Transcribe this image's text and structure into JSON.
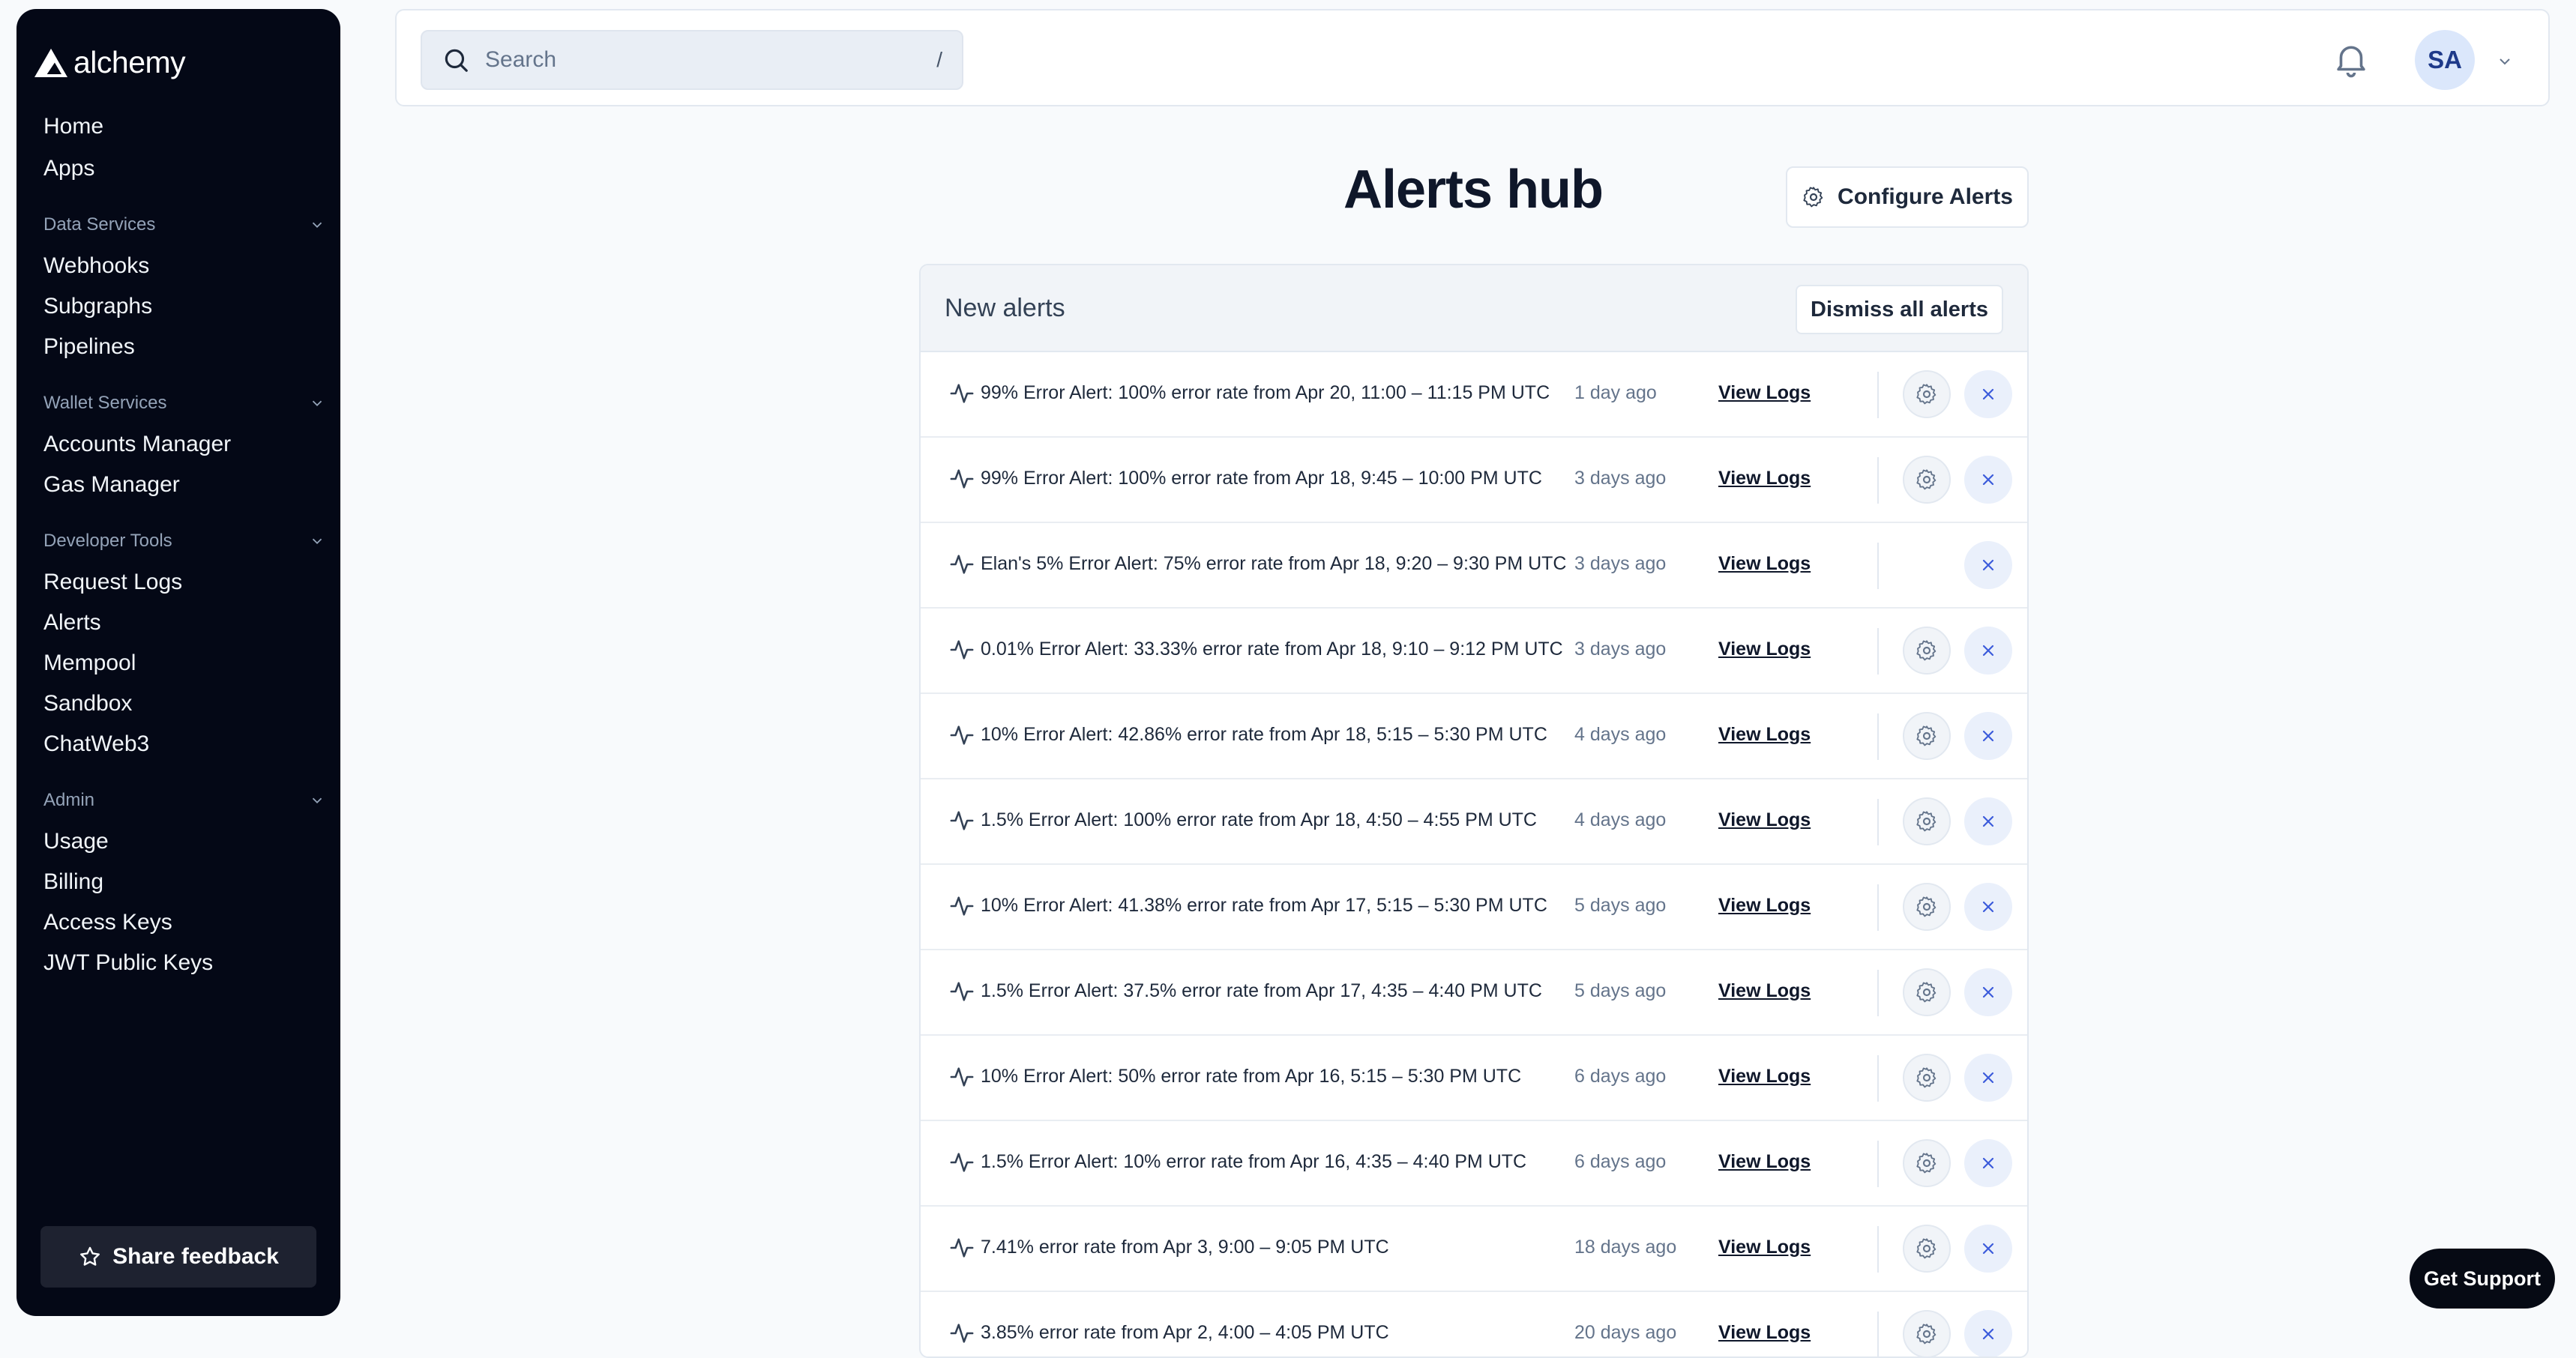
{
  "app": {
    "name": "alchemy"
  },
  "sidebar": {
    "top_items": [
      {
        "label": "Home"
      },
      {
        "label": "Apps"
      }
    ],
    "sections": [
      {
        "title": "Data Services",
        "items": [
          {
            "label": "Webhooks"
          },
          {
            "label": "Subgraphs"
          },
          {
            "label": "Pipelines"
          }
        ]
      },
      {
        "title": "Wallet Services",
        "items": [
          {
            "label": "Accounts Manager"
          },
          {
            "label": "Gas Manager"
          }
        ]
      },
      {
        "title": "Developer Tools",
        "items": [
          {
            "label": "Request Logs"
          },
          {
            "label": "Alerts"
          },
          {
            "label": "Mempool"
          },
          {
            "label": "Sandbox"
          },
          {
            "label": "ChatWeb3"
          }
        ]
      },
      {
        "title": "Admin",
        "items": [
          {
            "label": "Usage"
          },
          {
            "label": "Billing"
          },
          {
            "label": "Access Keys"
          },
          {
            "label": "JWT Public Keys"
          }
        ]
      }
    ],
    "feedback_label": "Share feedback"
  },
  "header": {
    "search": {
      "placeholder": "Search",
      "shortcut": "/"
    },
    "avatar_initials": "SA"
  },
  "main": {
    "title": "Alerts hub",
    "configure_label": "Configure Alerts",
    "panel": {
      "title": "New alerts",
      "dismiss_label": "Dismiss all alerts",
      "view_logs_label": "View Logs",
      "alerts": [
        {
          "text": "99% Error Alert: 100% error rate from Apr 20, 11:00 – 11:15 PM UTC",
          "ago": "1 day ago",
          "has_settings": true
        },
        {
          "text": "99% Error Alert: 100% error rate from Apr 18, 9:45 – 10:00 PM UTC",
          "ago": "3 days ago",
          "has_settings": true
        },
        {
          "text": "Elan's 5% Error Alert: 75% error rate from Apr 18, 9:20 – 9:30 PM UTC",
          "ago": "3 days ago",
          "has_settings": false
        },
        {
          "text": "0.01% Error Alert: 33.33% error rate from Apr 18, 9:10 – 9:12 PM UTC",
          "ago": "3 days ago",
          "has_settings": true
        },
        {
          "text": "10% Error Alert: 42.86% error rate from Apr 18, 5:15 – 5:30 PM UTC",
          "ago": "4 days ago",
          "has_settings": true
        },
        {
          "text": "1.5% Error Alert: 100% error rate from Apr 18, 4:50 – 4:55 PM UTC",
          "ago": "4 days ago",
          "has_settings": true
        },
        {
          "text": "10% Error Alert: 41.38% error rate from Apr 17, 5:15 – 5:30 PM UTC",
          "ago": "5 days ago",
          "has_settings": true
        },
        {
          "text": "1.5% Error Alert: 37.5% error rate from Apr 17, 4:35 – 4:40 PM UTC",
          "ago": "5 days ago",
          "has_settings": true
        },
        {
          "text": "10% Error Alert: 50% error rate from Apr 16, 5:15 – 5:30 PM UTC",
          "ago": "6 days ago",
          "has_settings": true
        },
        {
          "text": "1.5% Error Alert: 10% error rate from Apr 16, 4:35 – 4:40 PM UTC",
          "ago": "6 days ago",
          "has_settings": true
        },
        {
          "text": "7.41% error rate from Apr 3, 9:00 – 9:05 PM UTC",
          "ago": "18 days ago",
          "has_settings": true
        },
        {
          "text": "3.85% error rate from Apr 2, 4:00 – 4:05 PM UTC",
          "ago": "20 days ago",
          "has_settings": true
        }
      ]
    }
  },
  "support_label": "Get Support"
}
